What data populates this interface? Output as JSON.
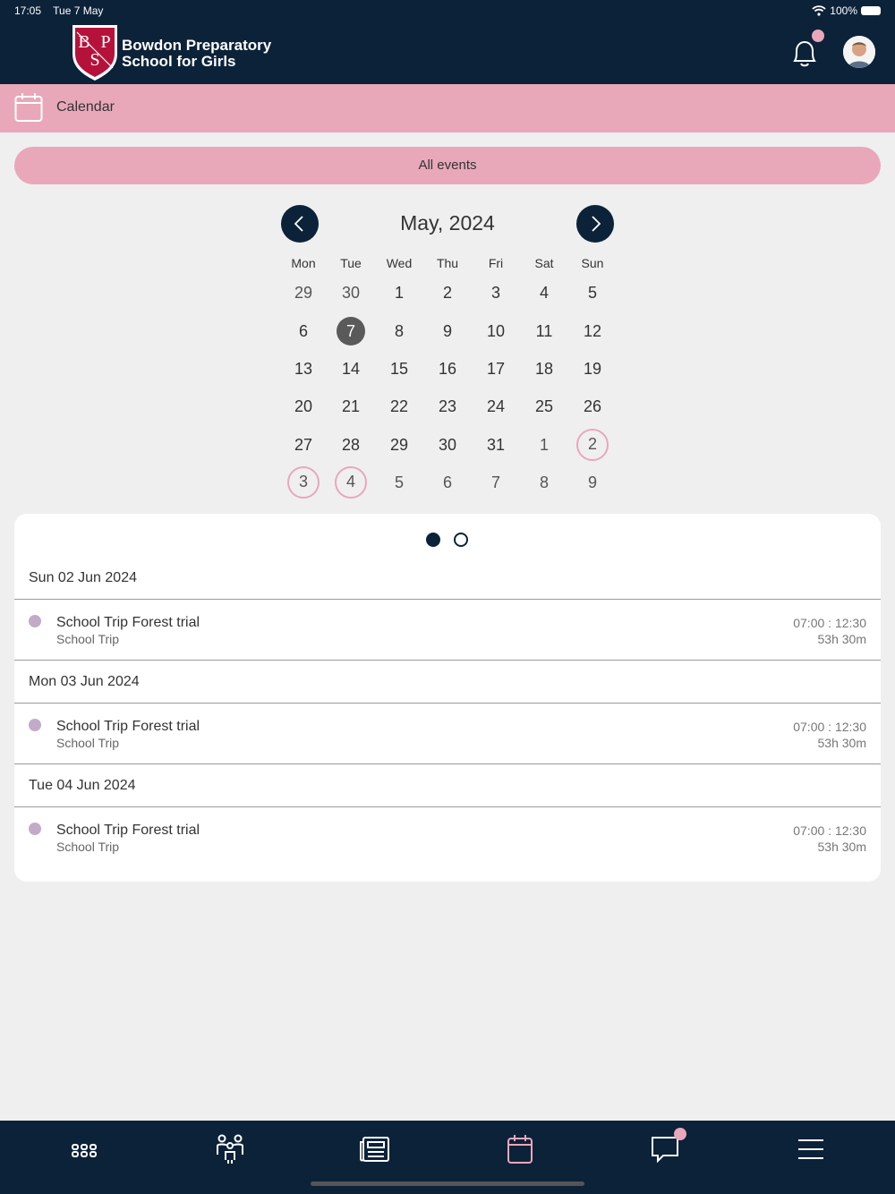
{
  "status_bar": {
    "time": "17:05",
    "date": "Tue 7 May",
    "battery": "100%"
  },
  "header": {
    "school_name_line1": "Bowdon Preparatory",
    "school_name_line2": "School for Girls",
    "logo_letters": [
      "B",
      "P",
      "S"
    ]
  },
  "section": {
    "title": "Calendar"
  },
  "filter": {
    "label": "All events"
  },
  "calendar": {
    "month_title": "May, 2024",
    "weekdays": [
      "Mon",
      "Tue",
      "Wed",
      "Thu",
      "Fri",
      "Sat",
      "Sun"
    ],
    "weeks": [
      [
        "29",
        "30",
        "1",
        "2",
        "3",
        "4",
        "5"
      ],
      [
        "6",
        "7",
        "8",
        "9",
        "10",
        "11",
        "12"
      ],
      [
        "13",
        "14",
        "15",
        "16",
        "17",
        "18",
        "19"
      ],
      [
        "20",
        "21",
        "22",
        "23",
        "24",
        "25",
        "26"
      ],
      [
        "27",
        "28",
        "29",
        "30",
        "31",
        "1",
        "2"
      ],
      [
        "3",
        "4",
        "5",
        "6",
        "7",
        "8",
        "9"
      ]
    ]
  },
  "events": {
    "groups": [
      {
        "date": "Sun 02 Jun 2024",
        "title": "School Trip Forest trial",
        "category": "School Trip",
        "start": "07:00",
        "end": "12:30",
        "duration": "53h 30m"
      },
      {
        "date": "Mon 03 Jun 2024",
        "title": "School Trip Forest trial",
        "category": "School Trip",
        "start": "07:00",
        "end": "12:30",
        "duration": "53h 30m"
      },
      {
        "date": "Tue 04 Jun 2024",
        "title": "School Trip Forest trial",
        "category": "School Trip",
        "start": "07:00",
        "end": "12:30",
        "duration": "53h 30m"
      }
    ]
  },
  "colors": {
    "navy": "#0c2239",
    "pink": "#e8a8ba",
    "event_dot": "#c4aac9",
    "crest_red": "#b5123b"
  },
  "tabbar": {
    "icons": [
      "apps-grid-icon",
      "people-icon",
      "news-icon",
      "calendar-icon",
      "chat-icon",
      "menu-icon"
    ],
    "active": "calendar-icon"
  }
}
